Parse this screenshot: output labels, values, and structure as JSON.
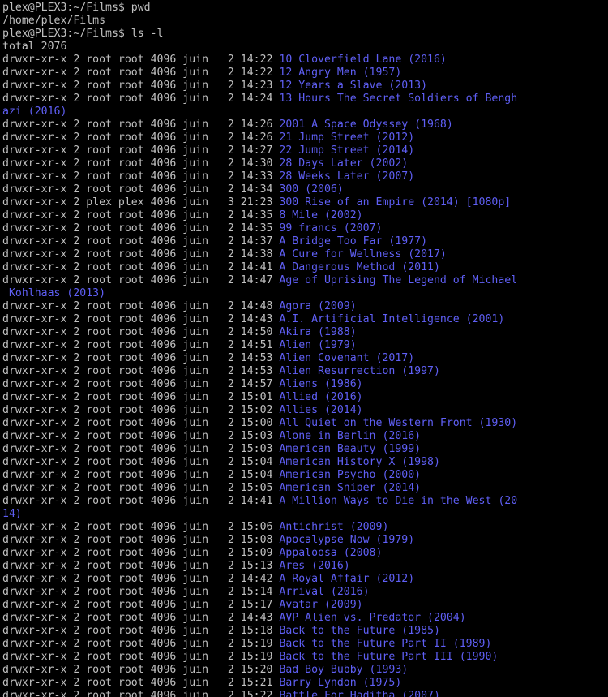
{
  "colors": {
    "background": "#000000",
    "text": "#c0c0c0",
    "directory": "#5f5ff5"
  },
  "terminal": {
    "lines": [
      {
        "t": "plex@PLEX3:~/Films$ pwd"
      },
      {
        "t": "/home/plex/Films"
      },
      {
        "t": "plex@PLEX3:~/Films$ ls -l"
      },
      {
        "t": "total 2076"
      },
      {
        "p": "drwxr-xr-x 2 root root 4096 juin   2 14:22 ",
        "d": "10 Cloverfield Lane (2016)"
      },
      {
        "p": "drwxr-xr-x 2 root root 4096 juin   2 14:22 ",
        "d": "12 Angry Men (1957)"
      },
      {
        "p": "drwxr-xr-x 2 root root 4096 juin   2 14:23 ",
        "d": "12 Years a Slave (2013)"
      },
      {
        "p": "drwxr-xr-x 2 root root 4096 juin   2 14:24 ",
        "d": "13 Hours The Secret Soldiers of Bengh"
      },
      {
        "p": "",
        "d": "azi (2016)"
      },
      {
        "p": "drwxr-xr-x 2 root root 4096 juin   2 14:26 ",
        "d": "2001 A Space Odyssey (1968)"
      },
      {
        "p": "drwxr-xr-x 2 root root 4096 juin   2 14:26 ",
        "d": "21 Jump Street (2012)"
      },
      {
        "p": "drwxr-xr-x 2 root root 4096 juin   2 14:27 ",
        "d": "22 Jump Street (2014)"
      },
      {
        "p": "drwxr-xr-x 2 root root 4096 juin   2 14:30 ",
        "d": "28 Days Later (2002)"
      },
      {
        "p": "drwxr-xr-x 2 root root 4096 juin   2 14:33 ",
        "d": "28 Weeks Later (2007)"
      },
      {
        "p": "drwxr-xr-x 2 root root 4096 juin   2 14:34 ",
        "d": "300 (2006)"
      },
      {
        "p": "drwxr-xr-x 2 plex plex 4096 juin   3 21:23 ",
        "d": "300 Rise of an Empire (2014) [1080p]"
      },
      {
        "p": "drwxr-xr-x 2 root root 4096 juin   2 14:35 ",
        "d": "8 Mile (2002)"
      },
      {
        "p": "drwxr-xr-x 2 root root 4096 juin   2 14:35 ",
        "d": "99 francs (2007)"
      },
      {
        "p": "drwxr-xr-x 2 root root 4096 juin   2 14:37 ",
        "d": "A Bridge Too Far (1977)"
      },
      {
        "p": "drwxr-xr-x 2 root root 4096 juin   2 14:38 ",
        "d": "A Cure for Wellness (2017)"
      },
      {
        "p": "drwxr-xr-x 2 root root 4096 juin   2 14:41 ",
        "d": "A Dangerous Method (2011)"
      },
      {
        "p": "drwxr-xr-x 2 root root 4096 juin   2 14:47 ",
        "d": "Age of Uprising The Legend of Michael"
      },
      {
        "p": "",
        "d": " Kohlhaas (2013)"
      },
      {
        "p": "drwxr-xr-x 2 root root 4096 juin   2 14:48 ",
        "d": "Agora (2009)"
      },
      {
        "p": "drwxr-xr-x 2 root root 4096 juin   2 14:43 ",
        "d": "A.I. Artificial Intelligence (2001)"
      },
      {
        "p": "drwxr-xr-x 2 root root 4096 juin   2 14:50 ",
        "d": "Akira (1988)"
      },
      {
        "p": "drwxr-xr-x 2 root root 4096 juin   2 14:51 ",
        "d": "Alien (1979)"
      },
      {
        "p": "drwxr-xr-x 2 root root 4096 juin   2 14:53 ",
        "d": "Alien Covenant (2017)"
      },
      {
        "p": "drwxr-xr-x 2 root root 4096 juin   2 14:53 ",
        "d": "Alien Resurrection (1997)"
      },
      {
        "p": "drwxr-xr-x 2 root root 4096 juin   2 14:57 ",
        "d": "Aliens (1986)"
      },
      {
        "p": "drwxr-xr-x 2 root root 4096 juin   2 15:01 ",
        "d": "Allied (2016)"
      },
      {
        "p": "drwxr-xr-x 2 root root 4096 juin   2 15:02 ",
        "d": "Allies (2014)"
      },
      {
        "p": "drwxr-xr-x 2 root root 4096 juin   2 15:00 ",
        "d": "All Quiet on the Western Front (1930)"
      },
      {
        "p": "drwxr-xr-x 2 root root 4096 juin   2 15:03 ",
        "d": "Alone in Berlin (2016)"
      },
      {
        "p": "drwxr-xr-x 2 root root 4096 juin   2 15:03 ",
        "d": "American Beauty (1999)"
      },
      {
        "p": "drwxr-xr-x 2 root root 4096 juin   2 15:04 ",
        "d": "American History X (1998)"
      },
      {
        "p": "drwxr-xr-x 2 root root 4096 juin   2 15:04 ",
        "d": "American Psycho (2000)"
      },
      {
        "p": "drwxr-xr-x 2 root root 4096 juin   2 15:05 ",
        "d": "American Sniper (2014)"
      },
      {
        "p": "drwxr-xr-x 2 root root 4096 juin   2 14:41 ",
        "d": "A Million Ways to Die in the West (20"
      },
      {
        "p": "",
        "d": "14)"
      },
      {
        "p": "drwxr-xr-x 2 root root 4096 juin   2 15:06 ",
        "d": "Antichrist (2009)"
      },
      {
        "p": "drwxr-xr-x 2 root root 4096 juin   2 15:08 ",
        "d": "Apocalypse Now (1979)"
      },
      {
        "p": "drwxr-xr-x 2 root root 4096 juin   2 15:09 ",
        "d": "Appaloosa (2008)"
      },
      {
        "p": "drwxr-xr-x 2 root root 4096 juin   2 15:13 ",
        "d": "Ares (2016)"
      },
      {
        "p": "drwxr-xr-x 2 root root 4096 juin   2 14:42 ",
        "d": "A Royal Affair (2012)"
      },
      {
        "p": "drwxr-xr-x 2 root root 4096 juin   2 15:14 ",
        "d": "Arrival (2016)"
      },
      {
        "p": "drwxr-xr-x 2 root root 4096 juin   2 15:17 ",
        "d": "Avatar (2009)"
      },
      {
        "p": "drwxr-xr-x 2 root root 4096 juin   2 14:43 ",
        "d": "AVP Alien vs. Predator (2004)"
      },
      {
        "p": "drwxr-xr-x 2 root root 4096 juin   2 15:18 ",
        "d": "Back to the Future (1985)"
      },
      {
        "p": "drwxr-xr-x 2 root root 4096 juin   2 15:19 ",
        "d": "Back to the Future Part II (1989)"
      },
      {
        "p": "drwxr-xr-x 2 root root 4096 juin   2 15:19 ",
        "d": "Back to the Future Part III (1990)"
      },
      {
        "p": "drwxr-xr-x 2 root root 4096 juin   2 15:20 ",
        "d": "Bad Boy Bubby (1993)"
      },
      {
        "p": "drwxr-xr-x 2 root root 4096 juin   2 15:21 ",
        "d": "Barry Lyndon (1975)"
      },
      {
        "p": "drwxr-xr-x 2 root root 4096 juin   2 15:22 ",
        "d": "Battle For Haditha (2007)"
      }
    ]
  }
}
